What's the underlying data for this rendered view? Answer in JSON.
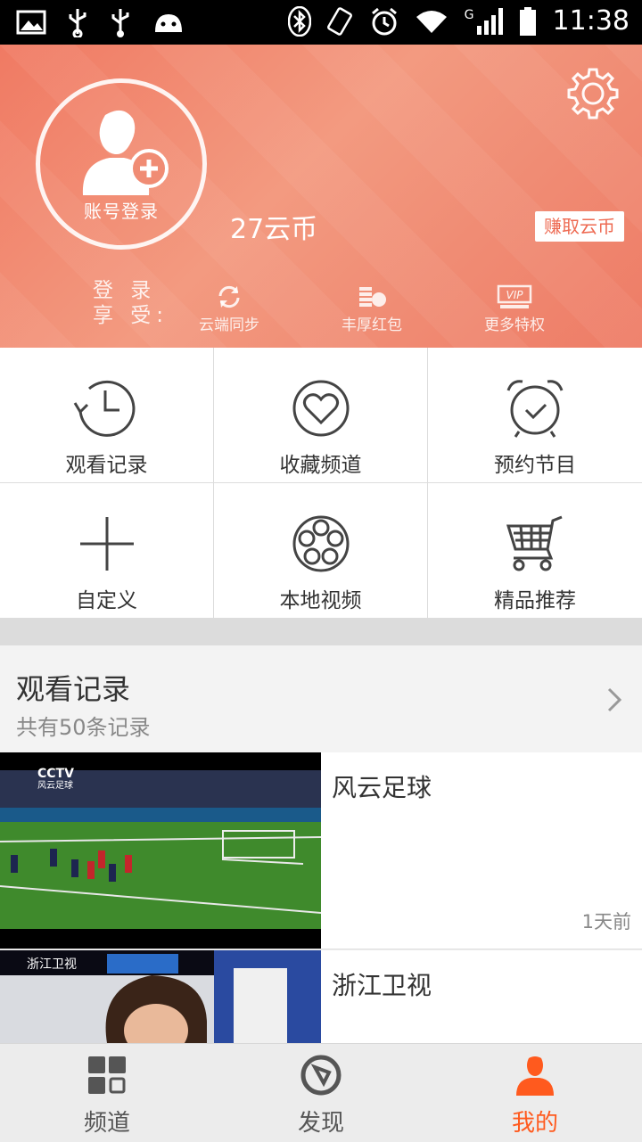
{
  "status_bar": {
    "time": "11:38",
    "network": "G"
  },
  "profile": {
    "avatar_label": "账号登录",
    "coins": "27云币",
    "earn_button": "赚取云币",
    "login_enjoy_line1": "登 录",
    "login_enjoy_line2": "享 受:",
    "perks": [
      {
        "label": "云端同步",
        "icon": "sync-icon"
      },
      {
        "label": "丰厚红包",
        "icon": "coins-icon"
      },
      {
        "label": "更多特权",
        "icon": "vip-icon"
      }
    ]
  },
  "grid": [
    {
      "label": "观看记录",
      "icon": "clock-history-icon"
    },
    {
      "label": "收藏频道",
      "icon": "heart-icon"
    },
    {
      "label": "预约节目",
      "icon": "alarm-clock-icon"
    },
    {
      "label": "自定义",
      "icon": "plus-icon"
    },
    {
      "label": "本地视频",
      "icon": "film-reel-icon"
    },
    {
      "label": "精品推荐",
      "icon": "cart-icon"
    }
  ],
  "history": {
    "title": "观看记录",
    "subtitle": "共有50条记录",
    "items": [
      {
        "title": "风云足球",
        "time": "1天前",
        "thumb_logo": "CCTV",
        "thumb_sub": "风云足球"
      },
      {
        "title": "浙江卫视",
        "time": "",
        "thumb_logo": "浙江卫视",
        "thumb_sub": ""
      }
    ]
  },
  "tabs": [
    {
      "label": "频道",
      "icon": "grid-icon",
      "active": false
    },
    {
      "label": "发现",
      "icon": "compass-icon",
      "active": false
    },
    {
      "label": "我的",
      "icon": "person-icon",
      "active": true
    }
  ],
  "colors": {
    "accent": "#ff5a1e",
    "profile_bg": "#f08c74"
  }
}
